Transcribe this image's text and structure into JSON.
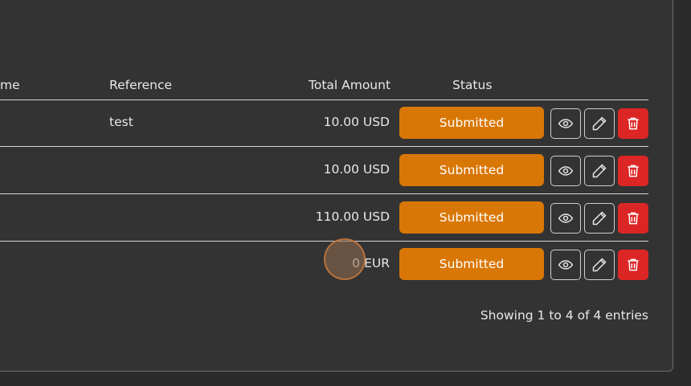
{
  "table": {
    "headers": {
      "name_partial": "me",
      "reference": "Reference",
      "total_amount": "Total Amount",
      "status": "Status"
    },
    "rows": [
      {
        "reference": "test",
        "amount": "10.00 USD",
        "status": "Submitted"
      },
      {
        "reference": "",
        "amount": "10.00 USD",
        "status": "Submitted"
      },
      {
        "reference": "",
        "amount": "110.00 USD",
        "status": "Submitted"
      },
      {
        "reference": "",
        "amount": "0 EUR",
        "status": "Submitted"
      }
    ],
    "actions": {
      "view_icon": "eye-icon",
      "edit_icon": "pencil-icon",
      "delete_icon": "trash-icon"
    }
  },
  "footer": {
    "summary": "Showing 1 to 4 of 4 entries"
  },
  "colors": {
    "status_submitted": "#d97706",
    "delete": "#dc2626",
    "panel": "#333333"
  }
}
